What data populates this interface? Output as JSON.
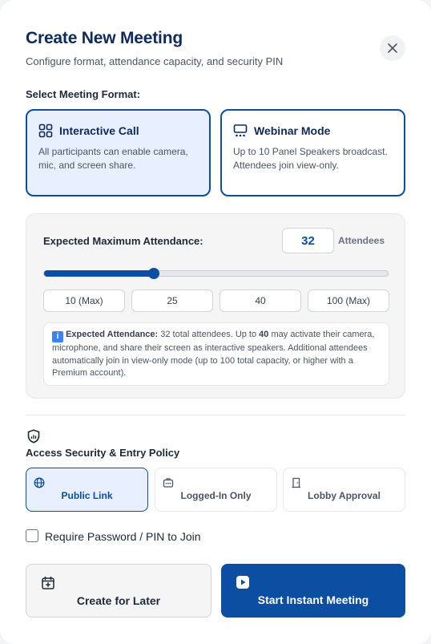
{
  "header": {
    "title": "Create New Meeting",
    "subtitle": "Configure format, attendance capacity, and security PIN"
  },
  "format": {
    "section_label": "Select Meeting Format:",
    "options": [
      {
        "label": "Interactive Call",
        "description": "All participants can enable camera, mic, and screen share.",
        "icon": "grid-icon",
        "selected": true
      },
      {
        "label": "Webinar Mode",
        "description": "Up to 10 Panel Speakers broadcast. Attendees join view-only.",
        "icon": "presentation-icon",
        "selected": false
      }
    ]
  },
  "attendance": {
    "label": "Expected Maximum Attendance:",
    "value": "32",
    "unit": "Attendees",
    "slider_fraction": 0.32,
    "presets": [
      "10 (Max)",
      "25",
      "40",
      "100 (Max)"
    ],
    "info_icon": "ℹ️",
    "info_title": "Expected Attendance:",
    "info_part1": " 32 total attendees. Up to ",
    "info_limit": "40",
    "info_part2": " may activate their camera, microphone, and share their screen as interactive speakers. Additional attendees automatically join in view-only mode (up to 100 total capacity, or higher with a Premium account)."
  },
  "security": {
    "section_label": "Access Security & Entry Policy",
    "options": [
      {
        "label": "Public Link",
        "icon": "globe-icon",
        "selected": true
      },
      {
        "label": "Logged-In Only",
        "icon": "id-badge-icon",
        "selected": false
      },
      {
        "label": "Lobby Approval",
        "icon": "door-icon",
        "selected": false
      }
    ],
    "password_label": "Require Password / PIN to Join",
    "password_checked": false
  },
  "actions": {
    "later_label": "Create for Later",
    "start_label": "Start Instant Meeting"
  },
  "colors": {
    "primary": "#0b4ea2",
    "title": "#0f2a5c",
    "selected_bg": "#e8efff"
  }
}
